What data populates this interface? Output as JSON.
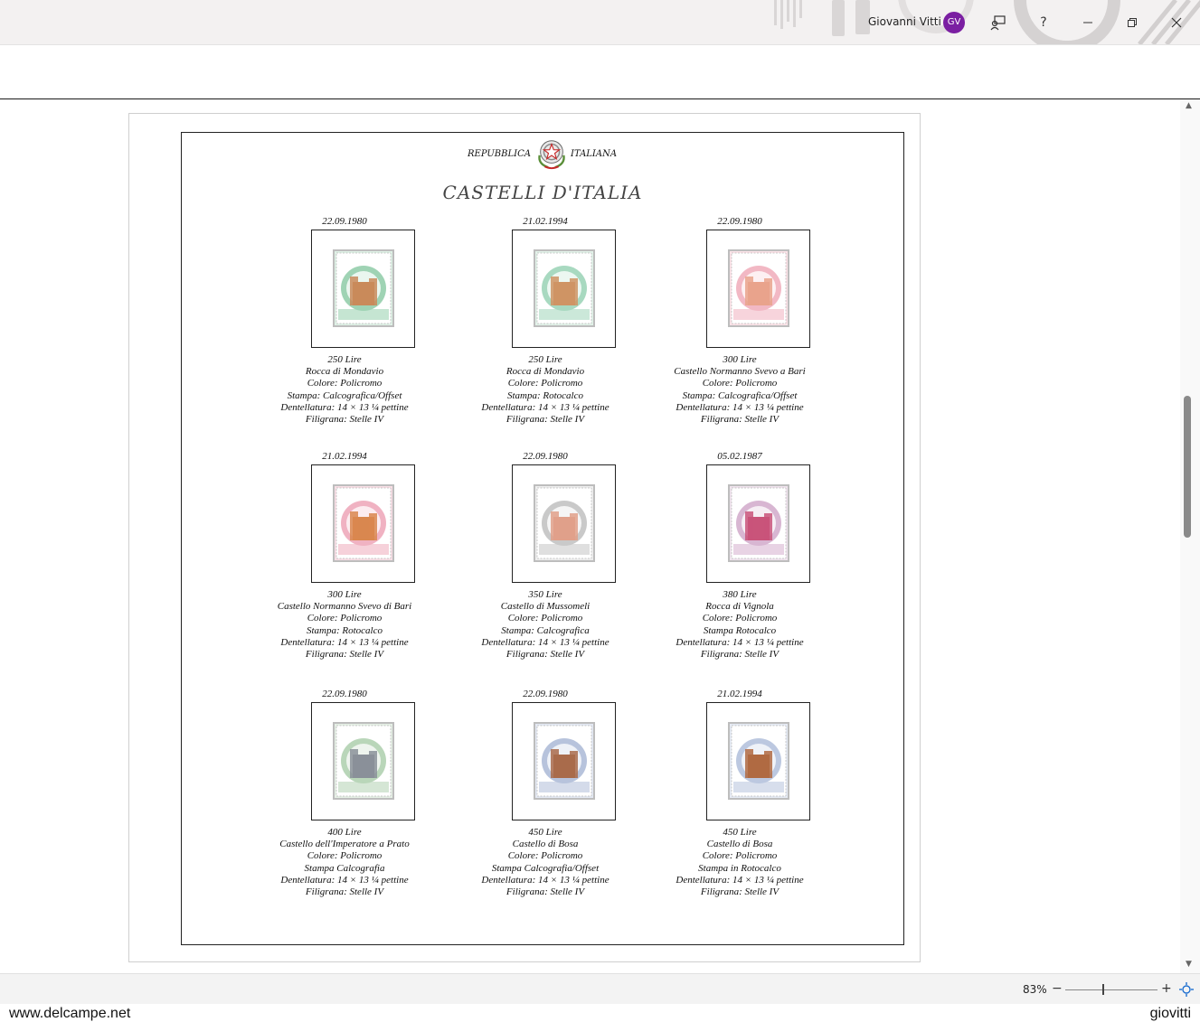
{
  "titlebar": {
    "user_name": "Giovanni Vitti",
    "avatar_initials": "GV",
    "help_label": "?"
  },
  "page": {
    "republic_left": "REPUBBLICA",
    "republic_right": "ITALIANA",
    "title": "CASTELLI   D'ITALIA",
    "stamps": [
      {
        "date": "22.09.1980",
        "lines": [
          "250 Lire",
          "Rocca di Mondavio",
          "Colore: Policromo",
          "Stampa: Calcografica/Offset",
          "Dentellatura: 14 × 13 ¼ pettine",
          "Filigrana: Stelle IV"
        ],
        "colors": {
          "ring": "#9fd3b4",
          "bg": "#dff1e6",
          "castle": "#c98a5a",
          "sky": "#eaf6ef"
        }
      },
      {
        "date": "21.02.1994",
        "lines": [
          "250 Lire",
          "Rocca di Mondavio",
          "Colore: Policromo",
          "Stampa: Rotocalco",
          "Dentellatura: 14 × 13 ¼ pettine",
          "Filigrana: Stelle IV"
        ],
        "colors": {
          "ring": "#a8d9c0",
          "bg": "#e2f2e9",
          "castle": "#cf9464",
          "sky": "#ecf7f1"
        }
      },
      {
        "date": "22.09.1980",
        "lines": [
          "300 Lire",
          "Castello Normanno Svevo a Bari",
          "Colore: Policromo",
          "Stampa: Calcografica/Offset",
          "Dentellatura: 14 × 13 ¼ pettine",
          "Filigrana: Stelle IV"
        ],
        "colors": {
          "ring": "#f2b8c4",
          "bg": "#fbe3e8",
          "castle": "#e9a38c",
          "sky": "#fdf0f2"
        }
      },
      {
        "date": "21.02.1994",
        "lines": [
          "300 Lire",
          "Castello Normanno Svevo di Bari",
          "Colore: Policromo",
          "Stampa: Rotocalco",
          "Dentellatura: 14 × 13 ¼ pettine",
          "Filigrana: Stelle IV"
        ],
        "colors": {
          "ring": "#f0b2c2",
          "bg": "#f8dfe6",
          "castle": "#d9874f",
          "sky": "#fcecf0"
        }
      },
      {
        "date": "22.09.1980",
        "lines": [
          "350 Lire",
          "Castello di Mussomeli",
          "Colore: Policromo",
          "Stampa: Calcografica",
          "Dentellatura: 14 × 13 ¼ pettine",
          "Filigrana: Stelle IV"
        ],
        "colors": {
          "ring": "#c9c9c9",
          "bg": "#eeeeee",
          "castle": "#e0a08a",
          "sky": "#f5f5f5"
        }
      },
      {
        "date": "05.02.1987",
        "lines": [
          "380 Lire",
          "Rocca di Vignola",
          "Colore: Policromo",
          "Stampa Rotocalco",
          "Dentellatura: 14 × 13 ¼ pettine",
          "Filigrana: Stelle IV"
        ],
        "colors": {
          "ring": "#d8b6d2",
          "bg": "#f0e4ee",
          "castle": "#c9547a",
          "sky": "#f6eef4"
        }
      },
      {
        "date": "22.09.1980",
        "lines": [
          "400 Lire",
          "Castello dell'Imperatore a Prato",
          "Colore: Policromo",
          "Stampa Calcografia",
          "Dentellatura: 14 × 13 ¼ pettine",
          "Filigrana: Stelle IV"
        ],
        "colors": {
          "ring": "#b9d6b9",
          "bg": "#e6f0e6",
          "castle": "#8a9099",
          "sky": "#eef4ee"
        }
      },
      {
        "date": "22.09.1980",
        "lines": [
          "450 Lire",
          "Castello di Bosa",
          "Colore: Policromo",
          "Stampa Calcografia/Offset",
          "Dentellatura: 14 × 13 ¼ pettine",
          "Filigrana: Stelle IV"
        ],
        "colors": {
          "ring": "#b7c3dc",
          "bg": "#e4e9f3",
          "castle": "#a96b4b",
          "sky": "#eef1f7"
        }
      },
      {
        "date": "21.02.1994",
        "lines": [
          "450 Lire",
          "Castello di Bosa",
          "Colore: Policromo",
          "Stampa in Rotocalco",
          "Dentellatura: 14 × 13 ¼ pettine",
          "Filigrana: Stelle IV"
        ],
        "colors": {
          "ring": "#bcc8e0",
          "bg": "#e6ebf4",
          "castle": "#b06a42",
          "sky": "#eff2f8"
        }
      }
    ]
  },
  "statusbar": {
    "zoom": "83%"
  },
  "watermark": {
    "left": "www.delcampe.net",
    "right": "giovitti"
  }
}
